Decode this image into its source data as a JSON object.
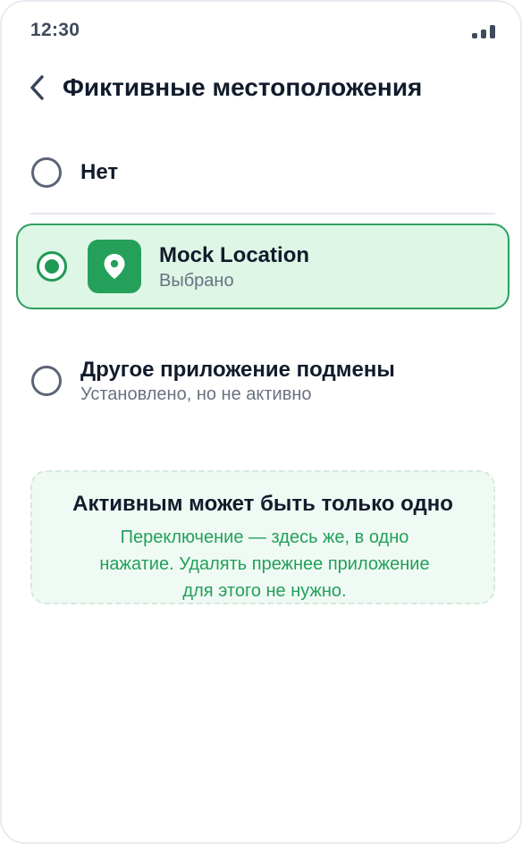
{
  "status_bar": {
    "time": "12:30"
  },
  "header": {
    "title": "Фиктивные местоположения"
  },
  "options": [
    {
      "title": "Нет",
      "selected": false
    },
    {
      "title": "Mock Location",
      "subtitle": "Выбрано",
      "selected": true,
      "icon": "map-pin-icon"
    },
    {
      "title": "Другое приложение подмены",
      "subtitle": "Установлено, но не активно",
      "selected": false
    }
  ],
  "info": {
    "title": "Активным может быть только одно",
    "body": "Переключение — здесь же, в одно нажатие. Удалять прежнее приложение для этого не нужно."
  },
  "colors": {
    "accent": "#1f9a55",
    "selected_background": "#ddf6e6",
    "info_text": "#22a05a"
  }
}
